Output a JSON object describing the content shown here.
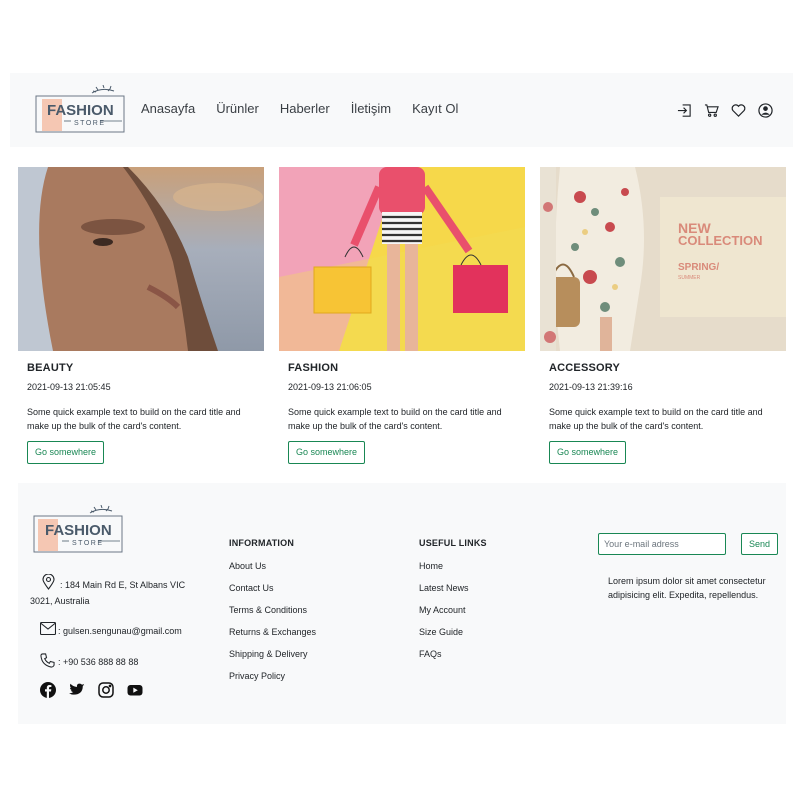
{
  "brand": {
    "name_top": "FASHION",
    "name_bottom": "STORE"
  },
  "nav": {
    "links": [
      "Anasayfa",
      "Ürünler",
      "Haberler",
      "İletişim",
      "Kayıt Ol"
    ],
    "icons": [
      "login-icon",
      "cart-icon",
      "heart-icon",
      "user-icon"
    ]
  },
  "cards": [
    {
      "title": "BEAUTY",
      "date": "2021-09-13 21:05:45",
      "text": "Some quick example text to build on the card title and make up the bulk of the card's content.",
      "button": "Go somewhere"
    },
    {
      "title": "FASHION",
      "date": "2021-09-13 21:06:05",
      "text": "Some quick example text to build on the card title and make up the bulk of the card's content.",
      "button": "Go somewhere"
    },
    {
      "title": "ACCESSORY",
      "date": "2021-09-13 21:39:16",
      "text": "Some quick example text to build on the card title and make up the bulk of the card's  content.",
      "button": "Go somewhere"
    }
  ],
  "promo": {
    "line1": "NEW",
    "line2": "COLLECTION",
    "line3": "SPRING/",
    "line4": "SUMMER"
  },
  "footer": {
    "address": ": 184 Main Rd E, St Albans VIC 3021, Australia",
    "email": ": gulsen.sengunau@gmail.com",
    "phone": ": +90 536 888 88 88",
    "social_icons": [
      "facebook-icon",
      "twitter-icon",
      "instagram-icon",
      "youtube-icon"
    ],
    "information": {
      "heading": "INFORMATION",
      "links": [
        "About Us",
        "Contact Us",
        "Terms & Conditions",
        "Returns & Exchanges",
        "Shipping & Delivery",
        "Privacy Policy"
      ]
    },
    "useful": {
      "heading": "USEFUL LINKS",
      "links": [
        "Home",
        "Latest News",
        "My Account",
        "Size Guide",
        "FAQs"
      ]
    },
    "newsletter": {
      "placeholder": "Your e-mail adress",
      "button": "Send"
    },
    "lorem": "Lorem ipsum dolor sit amet consectetur adipisicing elit. Expedita, repellendus."
  },
  "colors": {
    "accent": "#198754",
    "navbar_bg": "#f8f9fa",
    "logo_peach": "#f5c7b3",
    "logo_text": "#4a5a6a"
  }
}
